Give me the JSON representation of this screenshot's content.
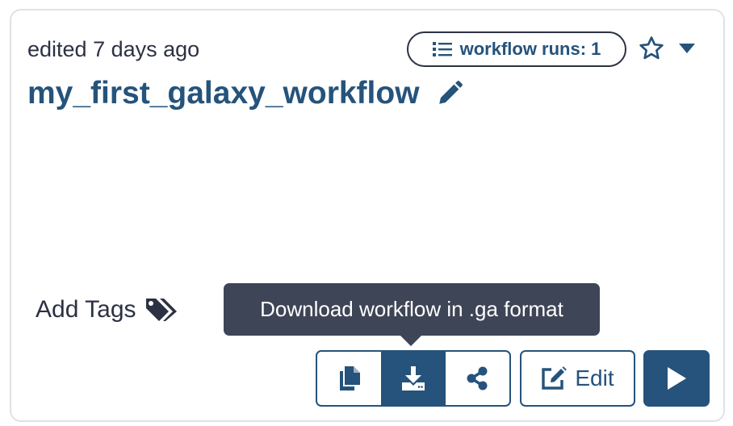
{
  "card": {
    "edited_label": "edited 7 days ago",
    "title": "my_first_galaxy_workflow",
    "runs_badge_label": "workflow runs: 1",
    "add_tags_label": "Add Tags",
    "tooltip_text": "Download workflow in .ga format",
    "edit_label": "Edit"
  },
  "icons": {
    "runs_badge": "list-icon",
    "favorite": "star-outline-icon",
    "menu": "caret-down-icon",
    "rename": "pencil-icon",
    "tags": "tags-icon",
    "copy": "copy-icon",
    "download": "download-icon",
    "share": "share-icon",
    "edit": "edit-icon",
    "run": "play-icon"
  },
  "colors": {
    "primary": "#25537b",
    "text": "#2c3143",
    "tooltip_bg": "#3e4556",
    "border": "#dee2e6"
  }
}
